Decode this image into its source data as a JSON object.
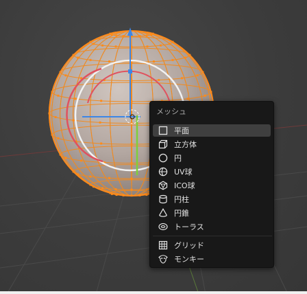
{
  "menu": {
    "title": "メッシュ",
    "items": [
      {
        "label": "平面",
        "icon": "plane-icon",
        "active": true
      },
      {
        "label": "立方体",
        "icon": "cube-icon"
      },
      {
        "label": "円",
        "icon": "circle-icon"
      },
      {
        "label": "UV球",
        "icon": "uv-sphere-icon"
      },
      {
        "label": "ICO球",
        "icon": "ico-sphere-icon"
      },
      {
        "label": "円柱",
        "icon": "cylinder-icon"
      },
      {
        "label": "円錐",
        "icon": "cone-icon"
      },
      {
        "label": "トーラス",
        "icon": "torus-icon"
      }
    ],
    "extra_items": [
      {
        "label": "グリッド",
        "icon": "grid-icon"
      },
      {
        "label": "モンキー",
        "icon": "monkey-icon"
      }
    ]
  },
  "colors": {
    "viewport_bg": "#3d3d3d",
    "menu_bg": "#181818",
    "highlight": "#3f3f3f",
    "wire_orange": "#ff8a1a",
    "gizmo_red": "#e0525f",
    "gizmo_blue": "#3d86e6",
    "gizmo_green": "#7fcf3a"
  }
}
